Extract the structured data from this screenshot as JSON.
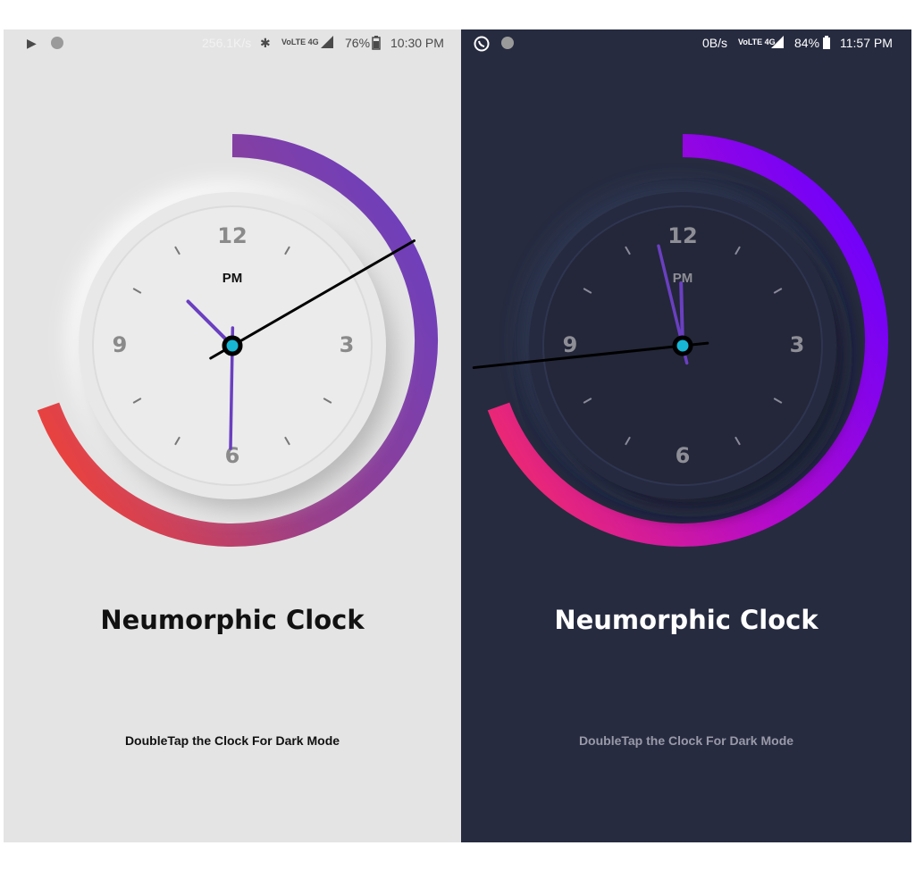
{
  "light": {
    "status": {
      "speed": "256.1K/s",
      "network": "VoLTE 4G",
      "battery": "76%",
      "time": "10:30 PM"
    },
    "clock": {
      "numbers": [
        "12",
        "3",
        "6",
        "9"
      ],
      "ampm": "PM",
      "hour": 10,
      "minute": 30,
      "second": 10
    },
    "title": "Neumorphic Clock",
    "hint": "DoubleTap the Clock For Dark Mode",
    "colors": {
      "background": "#e4e4e4",
      "arc_start": "#f24236",
      "arc_end": "#6a3fc0",
      "hands": "#6a3fc0",
      "second_hand": "#000000",
      "center_dot": "#17b6d4"
    }
  },
  "dark": {
    "status": {
      "speed": "0B/s",
      "network": "VoLTE 4G",
      "battery": "84%",
      "time": "11:57 PM"
    },
    "clock": {
      "numbers": [
        "12",
        "3",
        "6",
        "9"
      ],
      "ampm": "PM",
      "hour": 11,
      "minute": 57,
      "second": 44
    },
    "title": "Neumorphic Clock",
    "hint": "DoubleTap the Clock For Dark Mode",
    "colors": {
      "background": "#262b40",
      "arc_start": "#ef2a6e",
      "arc_end": "#6a00ff",
      "hands": "#6a3fc0",
      "second_hand": "#000000",
      "center_dot": "#17b6d4"
    }
  }
}
